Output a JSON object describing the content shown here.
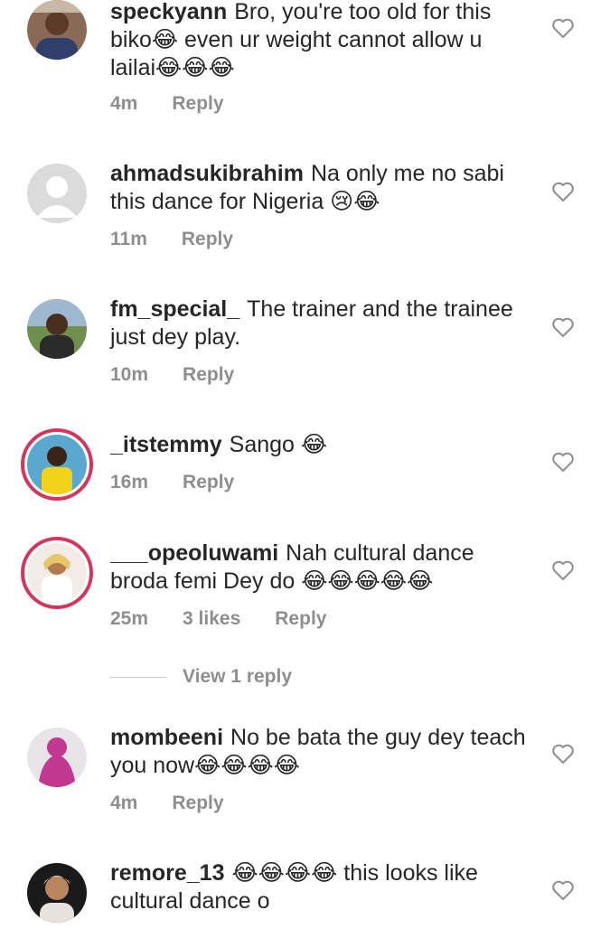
{
  "comments": [
    {
      "username": "speckyann",
      "text": "Bro, you're too old for this biko😂 even ur weight cannot allow u lailai😂😂😂",
      "time": "4m",
      "likes": "",
      "reply": "Reply"
    },
    {
      "username": "ahmadsukibrahim",
      "text": "Na only me no sabi this dance for Nigeria 😢😂",
      "time": "11m",
      "likes": "",
      "reply": "Reply"
    },
    {
      "username": "fm_special_",
      "text": "The trainer and the trainee just dey play.",
      "time": "10m",
      "likes": "",
      "reply": "Reply"
    },
    {
      "username": "_itstemmy",
      "text": "Sango 😂",
      "time": "16m",
      "likes": "",
      "reply": "Reply"
    },
    {
      "username": "___opeoluwami",
      "text": "Nah cultural dance broda femi Dey do 😂😂😂😂😂",
      "time": "25m",
      "likes": "3 likes",
      "reply": "Reply"
    },
    {
      "username": "mombeeni",
      "text": "No be bata the guy dey teach you now😂😂😂😂",
      "time": "4m",
      "likes": "",
      "reply": "Reply"
    },
    {
      "username": "remore_13",
      "text": "😂😂😂😂 this looks like cultural dance o",
      "time": "",
      "likes": "",
      "reply": ""
    }
  ],
  "view_replies": "View 1 reply",
  "icons": {
    "like": "heart-outline-icon"
  },
  "colors": {
    "text": "#262626",
    "muted": "#8e8e8e",
    "story_ring": "#d4345e"
  }
}
